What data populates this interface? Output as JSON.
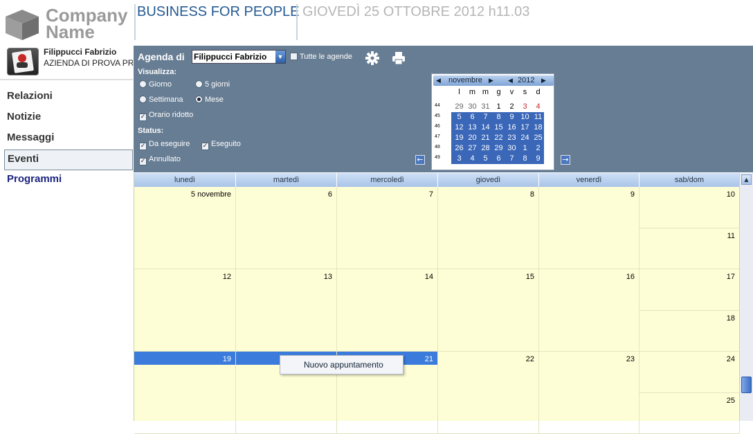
{
  "header": {
    "logo_line1": "Company",
    "logo_line2": "Name",
    "brand": "BUSINESS FOR PEOPLE",
    "datetime": "GIOVEDÌ 25 OTTOBRE 2012 h11.03"
  },
  "user": {
    "name": "Filippucci Fabrizio",
    "company": "AZIENDA DI PROVA PR",
    "avatar_label": "Name"
  },
  "nav": {
    "items": [
      {
        "label": "Relazioni"
      },
      {
        "label": "Notizie"
      },
      {
        "label": "Messaggi"
      },
      {
        "label": "Eventi",
        "selected": true
      },
      {
        "label": "Programmi"
      }
    ]
  },
  "controls": {
    "agenda_label": "Agenda di",
    "agenda_value": "Filippucci Fabrizio",
    "all_agendas": "Tutte le agende",
    "visualizza_label": "Visualizza:",
    "views": {
      "giorno": "Giorno",
      "cinque_giorni": "5 giorni",
      "settimana": "Settimana",
      "mese": "Mese"
    },
    "selected_view": "Mese",
    "orario_ridotto": "Orario ridotto",
    "status_label": "Status:",
    "status": {
      "da_eseguire": "Da eseguire",
      "eseguito": "Eseguito",
      "annullato": "Annullato"
    }
  },
  "mini_calendar": {
    "month": "novembre",
    "year": "2012",
    "weekday_headers": [
      "l",
      "m",
      "m",
      "g",
      "v",
      "s",
      "d"
    ],
    "week_numbers": [
      "44",
      "45",
      "46",
      "47",
      "48",
      "49"
    ],
    "weeks": [
      [
        "29",
        "30",
        "31",
        "1",
        "2",
        "3",
        "4"
      ],
      [
        "5",
        "6",
        "7",
        "8",
        "9",
        "10",
        "11"
      ],
      [
        "12",
        "13",
        "14",
        "15",
        "16",
        "17",
        "18"
      ],
      [
        "19",
        "20",
        "21",
        "22",
        "23",
        "24",
        "25"
      ],
      [
        "26",
        "27",
        "28",
        "29",
        "30",
        "1",
        "2"
      ],
      [
        "3",
        "4",
        "5",
        "6",
        "7",
        "8",
        "9"
      ]
    ]
  },
  "calendar": {
    "day_headers": [
      "lunedì",
      "martedì",
      "mercoledì",
      "giovedì",
      "venerdì",
      "sab/dom"
    ],
    "weeks": [
      {
        "days": [
          "5 novembre",
          "6",
          "7",
          "8",
          "9"
        ],
        "sat": "10",
        "sun": "11"
      },
      {
        "days": [
          "12",
          "13",
          "14",
          "15",
          "16"
        ],
        "sat": "17",
        "sun": "18"
      },
      {
        "days": [
          "19",
          "",
          "21",
          "22",
          "23"
        ],
        "sat": "24",
        "sun": "25"
      }
    ]
  },
  "context_menu": {
    "item": "Nuovo appuntamento"
  },
  "colors": {
    "panel": "#677d93",
    "calendar_bg": "#fefed6",
    "selection": "#3a7bdc",
    "brand": "#245a93"
  }
}
